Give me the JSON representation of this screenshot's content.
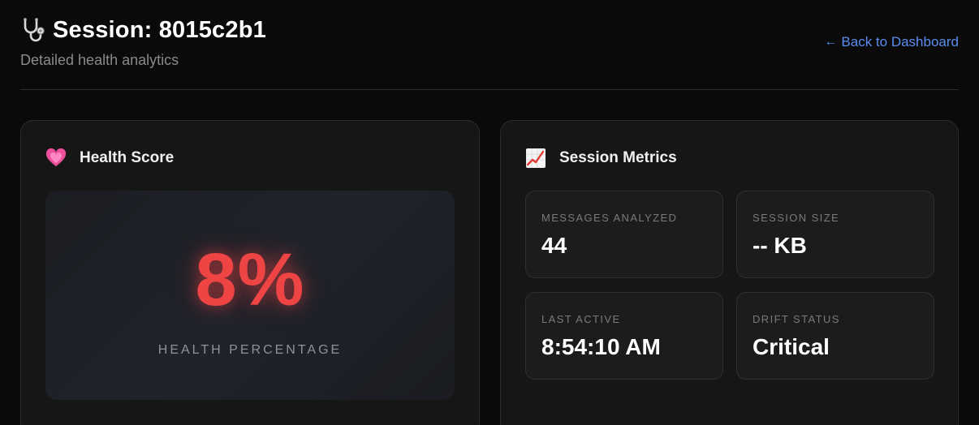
{
  "header": {
    "icon": "stethoscope-icon",
    "title": "Session: 8015c2b1",
    "subtitle": "Detailed health analytics",
    "back_link": {
      "arrow": "←",
      "label": "Back to Dashboard"
    }
  },
  "health_card": {
    "icon": "heart-icon",
    "title": "Health Score",
    "score": "8%",
    "score_label": "HEALTH PERCENTAGE"
  },
  "metrics_card": {
    "icon": "chart-increasing-icon",
    "title": "Session Metrics",
    "metrics": [
      {
        "label": "MESSAGES ANALYZED",
        "value": "44"
      },
      {
        "label": "SESSION SIZE",
        "value": "-- KB"
      },
      {
        "label": "LAST ACTIVE",
        "value": "8:54:10 AM"
      },
      {
        "label": "DRIFT STATUS",
        "value": "Critical"
      }
    ]
  },
  "colors": {
    "background": "#0a0a0a",
    "card": "#161616",
    "accent_link": "#5b8def",
    "score_critical": "#ef4444"
  }
}
